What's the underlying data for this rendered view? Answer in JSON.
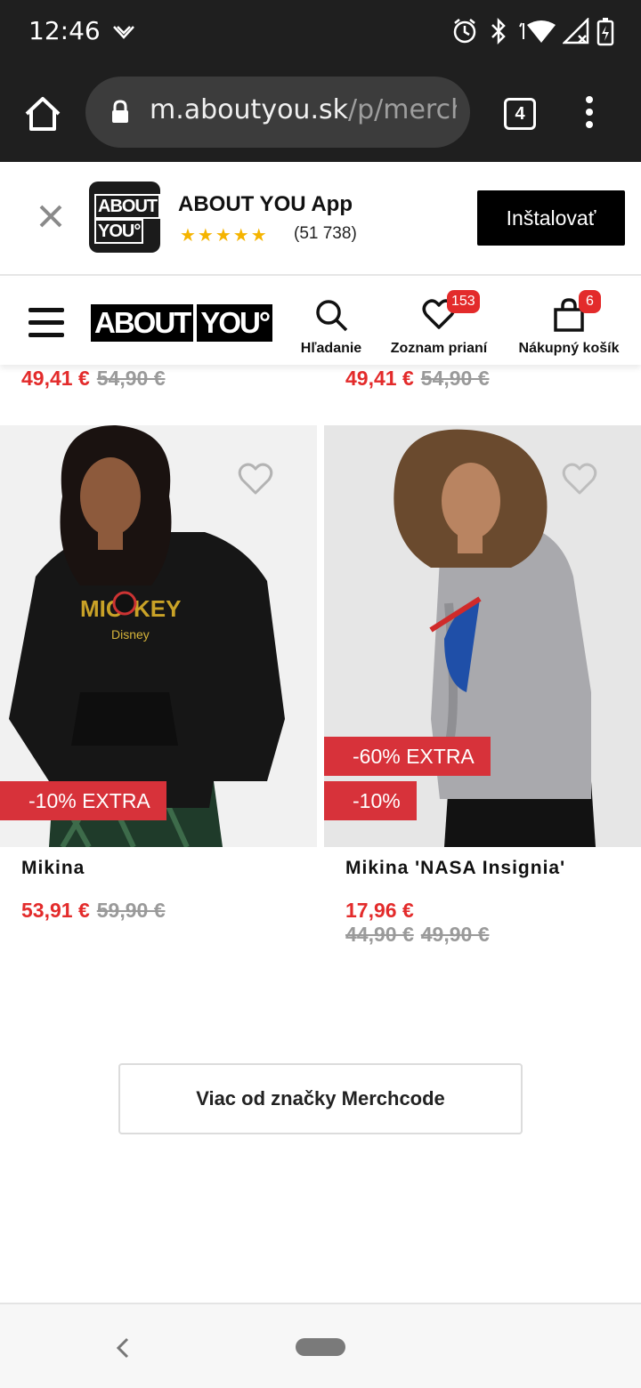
{
  "status_bar": {
    "time": "12:46",
    "icons": [
      "signal-app-icon",
      "alarm-icon",
      "bluetooth-icon",
      "wifi-icon",
      "cellular-icon",
      "battery-icon"
    ]
  },
  "browser": {
    "url_host": "m.aboutyou.sk",
    "url_path": "/p/merch",
    "tab_count": "4"
  },
  "app_banner": {
    "logo_line1": "ABOUT",
    "logo_line2": "YOU°",
    "app_name": "ABOUT YOU App",
    "stars": "★★★★★",
    "rating_count": "(51 738)",
    "install_label": "Inštalovať"
  },
  "header": {
    "brand_left": "ABOUT",
    "brand_right": "YOU°",
    "search_label": "Hľadanie",
    "wishlist_label": "Zoznam prianí",
    "wishlist_count": "153",
    "cart_label": "Nákupný košík",
    "cart_count": "6"
  },
  "prev_row": [
    {
      "price": "49,41 €",
      "old_price": "54,90 €"
    },
    {
      "price": "49,41 €",
      "old_price": "54,90 €"
    }
  ],
  "products": [
    {
      "title": "Mikina",
      "price": "53,91 €",
      "old_price": "59,90 €",
      "tags": [
        "-10% EXTRA"
      ]
    },
    {
      "title": "Mikina 'NASA Insignia'",
      "price": "17,96 €",
      "old_price_1": "44,90 €",
      "old_price_2": "49,90 €",
      "tags": [
        "-60% EXTRA",
        "-10%"
      ]
    }
  ],
  "more_button": "Viac od značky Merchcode",
  "colors": {
    "sale_red": "#e32b2b",
    "tag_red": "#d7323a",
    "chrome_dark": "#1f1f1f"
  }
}
